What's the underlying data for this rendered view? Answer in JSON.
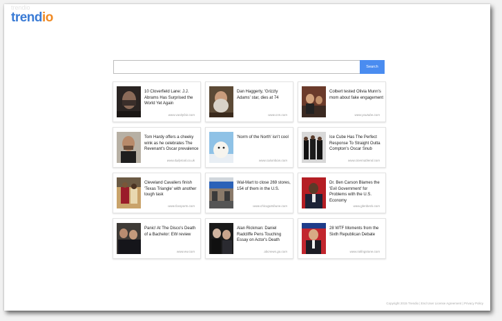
{
  "brand": {
    "logo_part1": "trend",
    "logo_part2": "io",
    "logo_ghost": "trendio",
    "colors": {
      "primary": "#3a7bd5",
      "accent": "#f08a24"
    }
  },
  "search": {
    "placeholder": "",
    "value": "",
    "button_label": "Search",
    "button_color": "#4a8cf0"
  },
  "articles": [
    {
      "headline": "10 Cloverfield Lane: J.J. Abrams Has Surprised the World Yet Again",
      "source": "www.vanityfair.com",
      "thumb": "dark-face-photo"
    },
    {
      "headline": "Dan Haggerty, 'Grizzly Adams' star, dies at 74",
      "source": "www.cnn.com",
      "thumb": "bearded-man-photo"
    },
    {
      "headline": "Colbert tested Olivia Munn's mom about fake engagement",
      "source": "www.youtube.com",
      "thumb": "talk-show-photo"
    },
    {
      "headline": "Tom Hardy offers a cheeky wink as he celebrates The Revenant's Oscar prevalence",
      "source": "www.dailymail.co.uk",
      "thumb": "man-portrait-photo"
    },
    {
      "headline": "'Norm of the North' isn't cool",
      "source": "www.columbian.com",
      "thumb": "polar-bear-photo"
    },
    {
      "headline": "Ice Cube Has The Perfect Response To Straight Outta Compton's Oscar Snub",
      "source": "www.cinemablend.com",
      "thumb": "group-photo"
    },
    {
      "headline": "Cleveland Cavaliers finish 'Texas Triangle' with another tough task",
      "source": "www.foxsports.com",
      "thumb": "basketball-photo"
    },
    {
      "headline": "Wal-Mart to close 269 stores, 154 of them in the U.S.",
      "source": "www.chicagotribune.com",
      "thumb": "storefront-photo"
    },
    {
      "headline": "Dr. Ben Carson Blames the 'Evil Government' for Problems with the U.S. Economy",
      "source": "www.glenbeck.com",
      "thumb": "speaker-photo"
    },
    {
      "headline": "Panic! At The Disco's Death of a Bachelor: EW review",
      "source": "www.ew.com",
      "thumb": "band-photo"
    },
    {
      "headline": "Alan Rickman: Daniel Radcliffe Pens Touching Essay on Actor's Death",
      "source": "abcnews.go.com",
      "thumb": "two-men-photo"
    },
    {
      "headline": "28 WTF Moments from the Sixth Republican Debate",
      "source": "www.rollingstone.com",
      "thumb": "debate-photo"
    }
  ],
  "footer": {
    "text": "Copyright 2015 Trendio | End User License Agreement | Privacy Policy"
  }
}
